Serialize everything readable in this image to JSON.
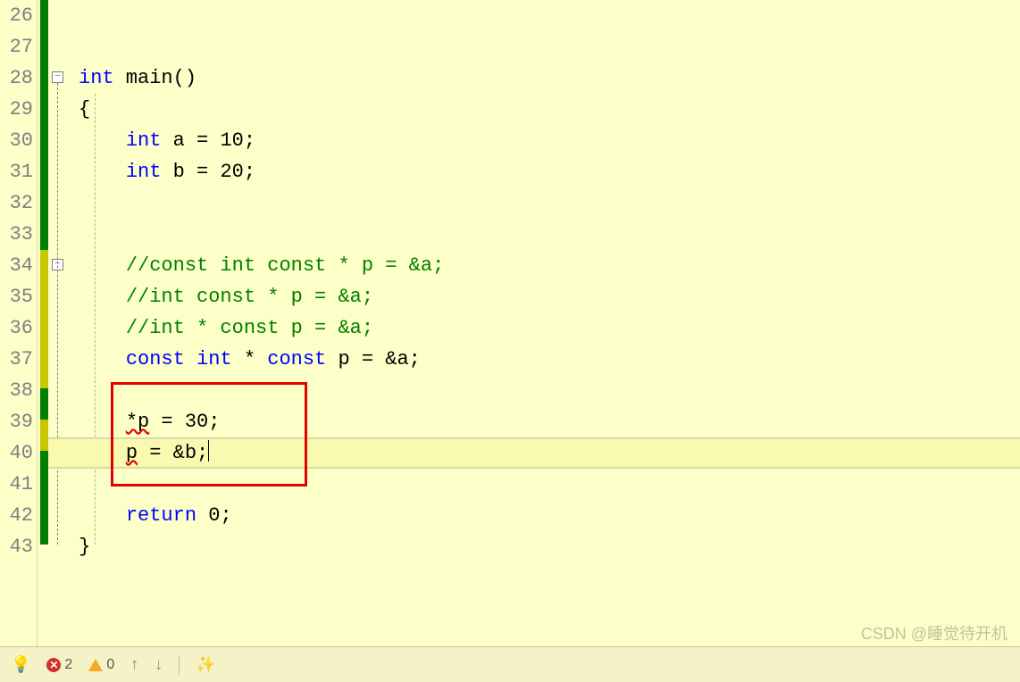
{
  "line_numbers": [
    "26",
    "27",
    "28",
    "29",
    "30",
    "31",
    "32",
    "33",
    "34",
    "35",
    "36",
    "37",
    "38",
    "39",
    "40",
    "41",
    "42",
    "43"
  ],
  "code": {
    "l28": {
      "kw": "int",
      "name": " main",
      "paren": "()"
    },
    "l29": {
      "brace": "{"
    },
    "l30": {
      "indent": "    ",
      "kw": "int",
      "rest": " a = ",
      "num": "10",
      "semi": ";"
    },
    "l31": {
      "indent": "    ",
      "kw": "int",
      "rest": " b = ",
      "num": "20",
      "semi": ";"
    },
    "l34": {
      "indent": "    ",
      "comment": "//const int const * p = &a;"
    },
    "l35": {
      "indent": "    ",
      "comment": "//int const * p = &a;"
    },
    "l36": {
      "indent": "    ",
      "comment": "//int * const p = &a;"
    },
    "l37": {
      "indent": "    ",
      "kw1": "const",
      "sp1": " ",
      "kw2": "int",
      "sp2": " * ",
      "kw3": "const",
      "rest": " p = &a;"
    },
    "l39": {
      "indent": "    ",
      "err": "*p",
      "rest": " = ",
      "num": "30",
      "semi": ";"
    },
    "l40": {
      "indent": "    ",
      "err": "p",
      "rest": " = &b;"
    },
    "l42": {
      "indent": "    ",
      "kw": "return",
      "sp": " ",
      "num": "0",
      "semi": ";"
    },
    "l43": {
      "brace": "}"
    }
  },
  "status": {
    "errors": "2",
    "warnings": "0"
  },
  "fold": {
    "sym": "−"
  },
  "watermark": "CSDN @睡觉待开机"
}
